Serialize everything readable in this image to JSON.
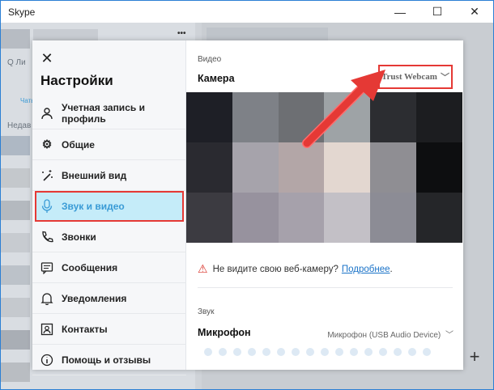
{
  "window": {
    "title": "Skype",
    "minimize": "—",
    "maximize": "☐",
    "close": "✕"
  },
  "bg": {
    "search": "Q  Ли",
    "chats": "Чаты",
    "recent": "Недав",
    "more": "•••"
  },
  "settings": {
    "close_icon": "✕",
    "title": "Настройки",
    "nav": [
      {
        "label": "Учетная запись и профиль",
        "icon": "person-icon"
      },
      {
        "label": "Общие",
        "icon": "gear-icon"
      },
      {
        "label": "Внешний вид",
        "icon": "magic-wand-icon"
      },
      {
        "label": "Звук и видео",
        "icon": "microphone-icon",
        "active": true
      },
      {
        "label": "Звонки",
        "icon": "phone-icon"
      },
      {
        "label": "Сообщения",
        "icon": "chat-icon"
      },
      {
        "label": "Уведомления",
        "icon": "bell-icon"
      },
      {
        "label": "Контакты",
        "icon": "contacts-icon"
      },
      {
        "label": "Помощь и отзывы",
        "icon": "info-icon"
      }
    ]
  },
  "video": {
    "section_label": "Видео",
    "camera_label": "Камера",
    "camera_selected": "Trust Webcam",
    "warning_text": "Не видите свою веб-камеру?",
    "warning_link": "Подробнее",
    "warning_suffix": ".",
    "preview_colors": [
      "#1e1f26",
      "#7e8187",
      "#6d6f73",
      "#9ea3a6",
      "#2c2d31",
      "#1c1d20",
      "#2a2a30",
      "#a6a3ab",
      "#b3a6a7",
      "#e3d7d0",
      "#8f8e93",
      "#0d0e10",
      "#3c3b41",
      "#97929e",
      "#a6a1ab",
      "#c3c0c6",
      "#8c8c95",
      "#252629"
    ]
  },
  "audio": {
    "section_label": "Звук",
    "mic_label": "Микрофон",
    "mic_selected": "Микрофон (USB Audio Device)",
    "level_dots": 16
  },
  "colors": {
    "accent": "#3a9bd6",
    "highlight": "#e53935"
  }
}
